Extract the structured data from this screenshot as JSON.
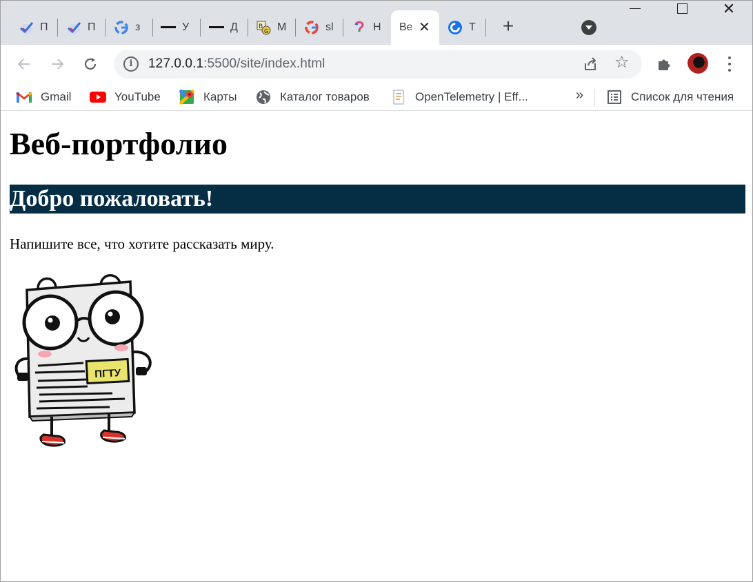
{
  "browser": {
    "tabs": [
      {
        "title": "П",
        "icon": "checkmark-icon"
      },
      {
        "title": "П",
        "icon": "checkmark-icon"
      },
      {
        "title": "з",
        "icon": "google-icon"
      },
      {
        "title": "У",
        "icon": "dash-icon"
      },
      {
        "title": "Д",
        "icon": "dash-icon"
      },
      {
        "title": "М",
        "icon": "dictionary-icon"
      },
      {
        "title": "sl",
        "icon": "google-icon"
      },
      {
        "title": "Н",
        "icon": "question-icon"
      },
      {
        "title": "Ве",
        "icon": "none",
        "active": true
      },
      {
        "title": "Т",
        "icon": "c-logo-icon"
      }
    ],
    "new_tab_label": "+",
    "close_tab_label": "✕"
  },
  "toolbar": {
    "url_host": "127.0.0.1",
    "url_path": ":5500/site/index.html",
    "star_label": "☆"
  },
  "bookmarks": {
    "items": [
      {
        "label": "Gmail",
        "icon": "gmail-icon"
      },
      {
        "label": "YouTube",
        "icon": "youtube-icon"
      },
      {
        "label": "Карты",
        "icon": "maps-icon"
      },
      {
        "label": "Каталог товаров",
        "icon": "globe-icon"
      },
      {
        "label": "OpenTelemetry | Eff...",
        "icon": "page-icon"
      }
    ],
    "more_label": "»",
    "reading_list_label": "Список для чтения"
  },
  "page": {
    "heading": "Веб-портфолио",
    "banner": "Добро пожаловать!",
    "banner_color": "#052e45",
    "paragraph": "Напишите все, что хотите рассказать миру.",
    "mascot_badge": "ПГТУ"
  }
}
